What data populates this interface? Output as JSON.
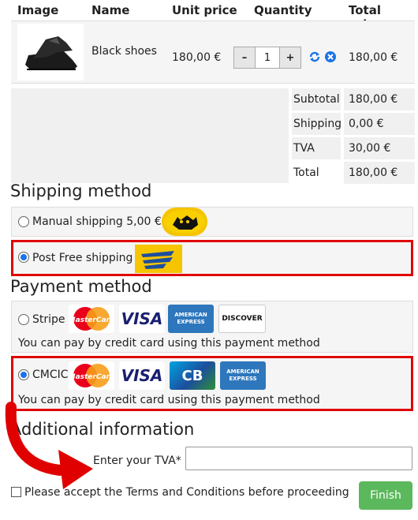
{
  "table": {
    "headers": [
      "Image",
      "Name",
      "Unit price",
      "Quantity",
      "Total price"
    ],
    "item": {
      "name": "Black shoes",
      "unit_price": "180,00 €",
      "quantity": "1",
      "total": "180,00 €",
      "minus": "–",
      "plus": "+"
    }
  },
  "totals": [
    {
      "label": "Subtotal",
      "value": "180,00 €"
    },
    {
      "label": "Shipping",
      "value": "0,00 €"
    },
    {
      "label": "TVA",
      "value": "30,00 €"
    },
    {
      "label": "Total",
      "value": "180,00 €"
    }
  ],
  "shipping": {
    "title": "Shipping method",
    "options": [
      {
        "label": "Manual shipping 5,00 €",
        "selected": false
      },
      {
        "label": "Post Free shipping",
        "selected": true
      }
    ]
  },
  "payment": {
    "title": "Payment method",
    "options": [
      {
        "label": "Stripe",
        "selected": false,
        "note": "You can pay by credit card using this payment method",
        "cards": [
          "MasterCard",
          "VISA",
          "AMERICAN EXPRESS",
          "DISCOVER"
        ]
      },
      {
        "label": "CMCIC",
        "selected": true,
        "note": "You can pay by credit card using this payment method",
        "cards": [
          "MasterCard",
          "VISA",
          "CB",
          "AMERICAN EXPRESS"
        ]
      }
    ]
  },
  "additional": {
    "title": "Additional information",
    "tva_label": "Enter your TVA*",
    "tva_value": ""
  },
  "terms_label": "Please accept the Terms and Conditions before proceeding",
  "finish_label": "Finish",
  "colors": {
    "highlight": "#e00000",
    "finish": "#5cb85c",
    "accent": "#1a73e8"
  }
}
